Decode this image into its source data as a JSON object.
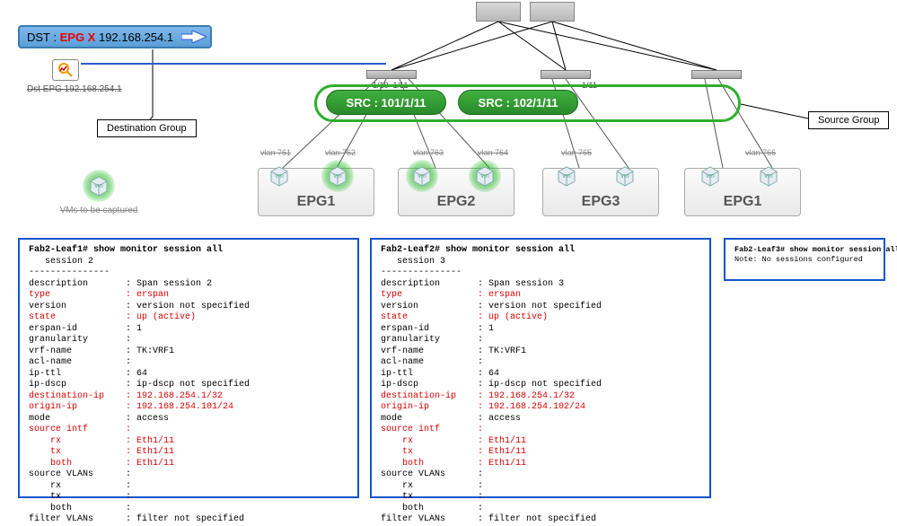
{
  "dst": {
    "prefix": "DST : ",
    "epg": "EPG X",
    "ip": " 192.168.254.1"
  },
  "analyzer_label": "Dst EPG 192.168.254.1",
  "callouts": {
    "dest": "Destination Group",
    "src": "Source Group"
  },
  "sources": {
    "src1": "SRC : 101/1/11",
    "src2": "SRC : 102/1/11"
  },
  "leaf_ports": {
    "a_left": "1/10",
    "a_right": "1/11",
    "b": "1/11"
  },
  "vlans": {
    "v1": "vlan 761",
    "v2": "vlan 762",
    "v3": "vlan 763",
    "v4": "vlan 764",
    "v5": "vlan 765",
    "v6": "vlan 766"
  },
  "epgs": {
    "e1": "EPG1",
    "e2": "EPG2",
    "e3": "EPG3",
    "e4": "EPG1"
  },
  "legend": "VMs to be captured",
  "terminal1": {
    "header": "Fab2-Leaf1# show monitor session all",
    "session": "   session 2",
    "dash": "---------------",
    "rows": [
      {
        "k": "description",
        "v": "Span session 2",
        "red": false
      },
      {
        "k": "type",
        "v": "erspan",
        "red": true
      },
      {
        "k": "version",
        "v": "version not specified",
        "red": false
      },
      {
        "k": "state",
        "v": "up (active)",
        "red": true
      },
      {
        "k": "erspan-id",
        "v": "1",
        "red": false
      },
      {
        "k": "granularity",
        "v": "",
        "red": false
      },
      {
        "k": "vrf-name",
        "v": "TK:VRF1",
        "red": false
      },
      {
        "k": "acl-name",
        "v": "",
        "red": false
      },
      {
        "k": "ip-ttl",
        "v": "64",
        "red": false
      },
      {
        "k": "ip-dscp",
        "v": "ip-dscp not specified",
        "red": false
      },
      {
        "k": "destination-ip",
        "v": "192.168.254.1/32",
        "red": true
      },
      {
        "k": "origin-ip",
        "v": "192.168.254.101/24",
        "red": true
      },
      {
        "k": "mode",
        "v": "access",
        "red": false
      },
      {
        "k": "source intf",
        "v": "",
        "red": true
      }
    ],
    "intf": [
      {
        "k": "rx",
        "v": "Eth1/11"
      },
      {
        "k": "tx",
        "v": "Eth1/11"
      },
      {
        "k": "both",
        "v": "Eth1/11"
      }
    ],
    "tail": [
      {
        "k": "source VLANs",
        "v": ""
      },
      {
        "k": "    rx",
        "v": ""
      },
      {
        "k": "    tx",
        "v": ""
      },
      {
        "k": "    both",
        "v": ""
      },
      {
        "k": "filter VLANs",
        "v": "filter not specified"
      }
    ]
  },
  "terminal2": {
    "header": "Fab2-Leaf2# show monitor session all",
    "session": "   session 3",
    "dash": "---------------",
    "rows": [
      {
        "k": "description",
        "v": "Span session 3",
        "red": false
      },
      {
        "k": "type",
        "v": "erspan",
        "red": true
      },
      {
        "k": "version",
        "v": "version not specified",
        "red": false
      },
      {
        "k": "state",
        "v": "up (active)",
        "red": true
      },
      {
        "k": "erspan-id",
        "v": "1",
        "red": false
      },
      {
        "k": "granularity",
        "v": "",
        "red": false
      },
      {
        "k": "vrf-name",
        "v": "TK:VRF1",
        "red": false
      },
      {
        "k": "acl-name",
        "v": "",
        "red": false
      },
      {
        "k": "ip-ttl",
        "v": "64",
        "red": false
      },
      {
        "k": "ip-dscp",
        "v": "ip-dscp not specified",
        "red": false
      },
      {
        "k": "destination-ip",
        "v": "192.168.254.1/32",
        "red": true
      },
      {
        "k": "origin-ip",
        "v": "192.168.254.102/24",
        "red": true
      },
      {
        "k": "mode",
        "v": "access",
        "red": false
      },
      {
        "k": "source intf",
        "v": "",
        "red": true
      }
    ],
    "intf": [
      {
        "k": "rx",
        "v": "Eth1/11"
      },
      {
        "k": "tx",
        "v": "Eth1/11"
      },
      {
        "k": "both",
        "v": "Eth1/11"
      }
    ],
    "tail": [
      {
        "k": "source VLANs",
        "v": ""
      },
      {
        "k": "    rx",
        "v": ""
      },
      {
        "k": "    tx",
        "v": ""
      },
      {
        "k": "    both",
        "v": ""
      },
      {
        "k": "filter VLANs",
        "v": "filter not specified"
      }
    ]
  },
  "terminal3": {
    "header": "Fab2-Leaf3# show monitor session all",
    "note": "Note: No sessions configured"
  }
}
